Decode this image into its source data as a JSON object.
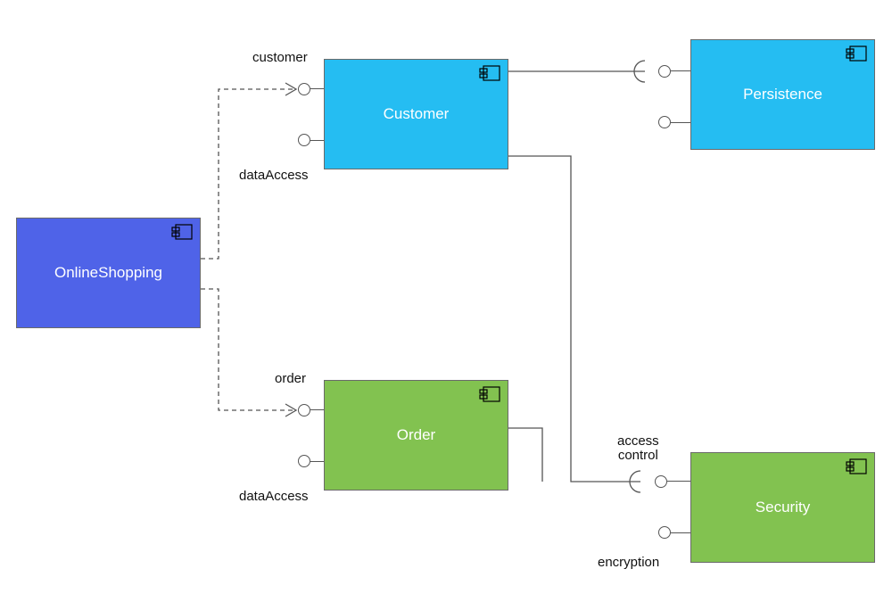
{
  "components": {
    "onlineShopping": {
      "name": "OnlineShopping",
      "fill": "#4f63e8"
    },
    "customer": {
      "name": "Customer",
      "fill": "#25bdf2"
    },
    "order": {
      "name": "Order",
      "fill": "#82c250"
    },
    "persistence": {
      "name": "Persistence",
      "fill": "#25bdf2"
    },
    "security": {
      "name": "Security",
      "fill": "#82c250"
    }
  },
  "interfaces": {
    "customer": "customer",
    "order": "order",
    "dataAccessCust": "dataAccess",
    "dataAccessOrd": "dataAccess",
    "accessControl": "access\ncontrol",
    "encryption": "encryption"
  }
}
